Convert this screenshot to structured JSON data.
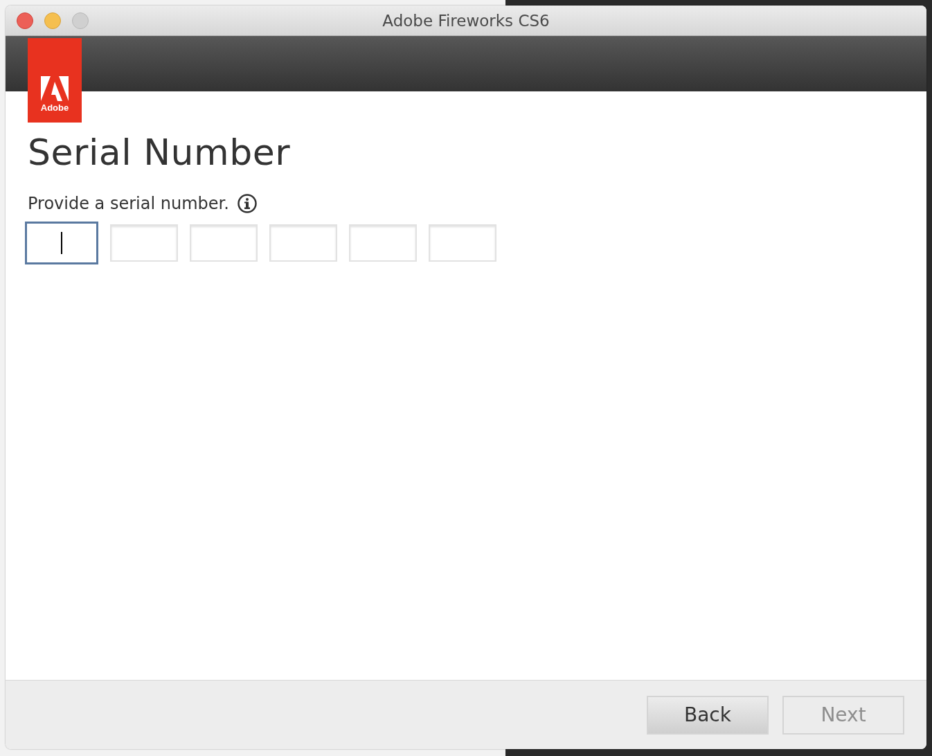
{
  "window": {
    "title": "Adobe Fireworks CS6"
  },
  "logo": {
    "label": "Adobe"
  },
  "heading": "Serial Number",
  "prompt": "Provide a serial number.",
  "serial_fields": [
    {
      "focused": true
    },
    {
      "focused": false
    },
    {
      "focused": false
    },
    {
      "focused": false
    },
    {
      "focused": false
    },
    {
      "focused": false
    }
  ],
  "buttons": [
    {
      "label": "Back",
      "disabled": false
    },
    {
      "label": "Next",
      "disabled": true
    }
  ]
}
